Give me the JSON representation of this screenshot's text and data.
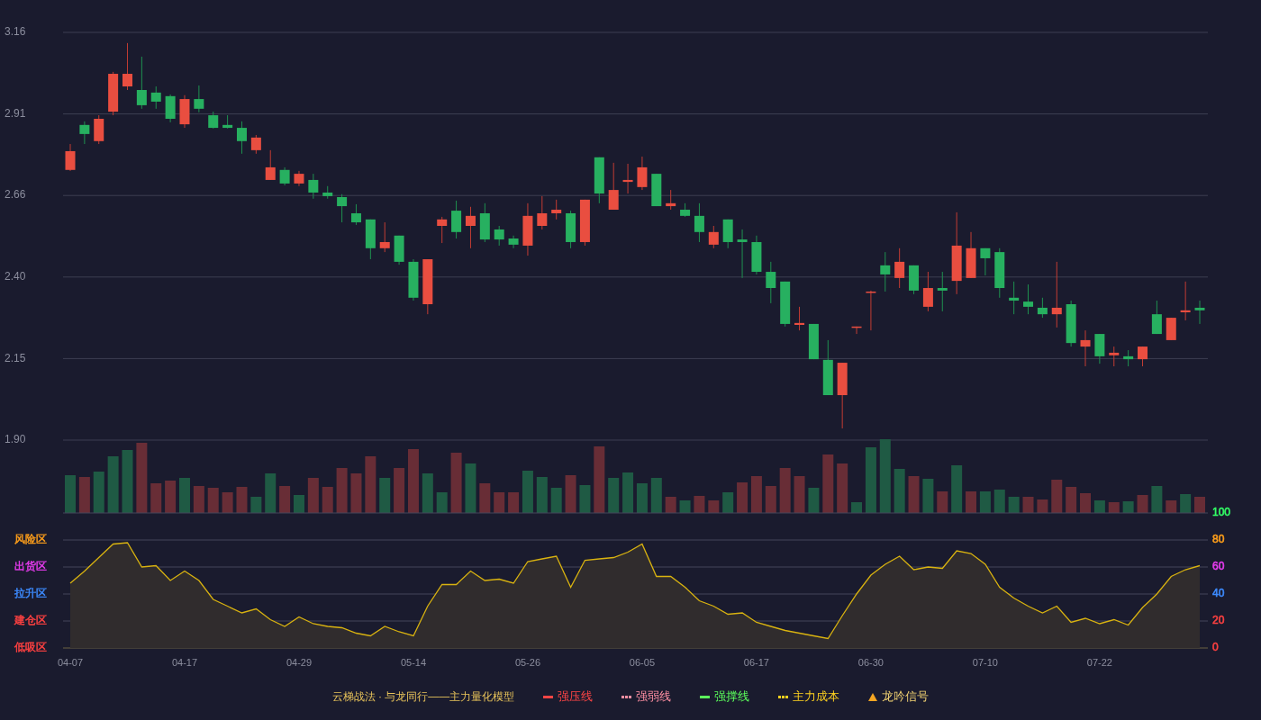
{
  "price_panel": {
    "chart_data": {
      "type": "candlestick",
      "categories": [
        null,
        null,
        null,
        null,
        null,
        null,
        null,
        null,
        null,
        null,
        null,
        null,
        null,
        null,
        null,
        null,
        null,
        null,
        null,
        null,
        null,
        null,
        null,
        null,
        null,
        null,
        null,
        null,
        null,
        null,
        null,
        null,
        null,
        null,
        null,
        null,
        null,
        null,
        null,
        null,
        null,
        null,
        null,
        null,
        null,
        null,
        null,
        null,
        null,
        null,
        null,
        null,
        null,
        null,
        null,
        null,
        null,
        null,
        null,
        null,
        null,
        null,
        null,
        null,
        null,
        null,
        null,
        null,
        null,
        null,
        null,
        null,
        null,
        null,
        null,
        null,
        null,
        null,
        null,
        null
      ],
      "ylim": [
        1.9,
        3.16
      ],
      "yticks": [
        {
          "value": 3.16,
          "label": "3.16"
        },
        {
          "value": 2.908,
          "label": "2.91"
        },
        {
          "value": 2.656,
          "label": "2.66"
        },
        {
          "value": 2.404,
          "label": "2.40"
        },
        {
          "value": 2.152,
          "label": "2.15"
        },
        {
          "value": 1.9,
          "label": "1.90"
        }
      ],
      "grid": true,
      "ohlc": [
        [
          2.735,
          2.815,
          2.732,
          2.793
        ],
        [
          2.874,
          2.885,
          2.815,
          2.846
        ],
        [
          2.824,
          2.904,
          2.815,
          2.893
        ],
        [
          2.915,
          3.038,
          2.904,
          3.032
        ],
        [
          2.993,
          3.127,
          2.982,
          3.032
        ],
        [
          2.982,
          3.085,
          2.924,
          2.935
        ],
        [
          2.974,
          2.993,
          2.924,
          2.946
        ],
        [
          2.963,
          2.968,
          2.882,
          2.893
        ],
        [
          2.876,
          2.966,
          2.865,
          2.954
        ],
        [
          2.954,
          2.996,
          2.913,
          2.924
        ],
        [
          2.904,
          2.915,
          2.863,
          2.865
        ],
        [
          2.874,
          2.904,
          2.863,
          2.865
        ],
        [
          2.865,
          2.885,
          2.785,
          2.824
        ],
        [
          2.796,
          2.843,
          2.785,
          2.835
        ],
        [
          2.704,
          2.796,
          2.704,
          2.743
        ],
        [
          2.735,
          2.743,
          2.687,
          2.693
        ],
        [
          2.693,
          2.732,
          2.685,
          2.723
        ],
        [
          2.704,
          2.723,
          2.646,
          2.665
        ],
        [
          2.665,
          2.685,
          2.646,
          2.654
        ],
        [
          2.651,
          2.66,
          2.573,
          2.623
        ],
        [
          2.601,
          2.629,
          2.565,
          2.573
        ],
        [
          2.582,
          2.582,
          2.459,
          2.493
        ],
        [
          2.493,
          2.573,
          2.481,
          2.512
        ],
        [
          2.532,
          2.532,
          2.442,
          2.451
        ],
        [
          2.451,
          2.459,
          2.331,
          2.34
        ],
        [
          2.32,
          2.459,
          2.289,
          2.459
        ],
        [
          2.562,
          2.59,
          2.509,
          2.582
        ],
        [
          2.609,
          2.64,
          2.523,
          2.543
        ],
        [
          2.562,
          2.621,
          2.493,
          2.593
        ],
        [
          2.601,
          2.632,
          2.512,
          2.52
        ],
        [
          2.551,
          2.562,
          2.501,
          2.52
        ],
        [
          2.523,
          2.532,
          2.493,
          2.504
        ],
        [
          2.501,
          2.632,
          2.47,
          2.593
        ],
        [
          2.562,
          2.654,
          2.551,
          2.601
        ],
        [
          2.601,
          2.643,
          2.582,
          2.612
        ],
        [
          2.601,
          2.609,
          2.493,
          2.512
        ],
        [
          2.512,
          2.643,
          2.501,
          2.643
        ],
        [
          2.774,
          2.774,
          2.632,
          2.662
        ],
        [
          2.612,
          2.757,
          2.612,
          2.673
        ],
        [
          2.698,
          2.754,
          2.662,
          2.704
        ],
        [
          2.682,
          2.776,
          2.673,
          2.743
        ],
        [
          2.723,
          2.723,
          2.623,
          2.623
        ],
        [
          2.623,
          2.673,
          2.612,
          2.632
        ],
        [
          2.612,
          2.632,
          2.59,
          2.593
        ],
        [
          2.593,
          2.632,
          2.512,
          2.543
        ],
        [
          2.504,
          2.562,
          2.493,
          2.543
        ],
        [
          2.582,
          2.582,
          2.493,
          2.512
        ],
        [
          2.52,
          2.551,
          2.401,
          2.512
        ],
        [
          2.512,
          2.532,
          2.412,
          2.42
        ],
        [
          2.42,
          2.451,
          2.323,
          2.37
        ],
        [
          2.39,
          2.39,
          2.251,
          2.259
        ],
        [
          2.256,
          2.312,
          2.239,
          2.262
        ],
        [
          2.259,
          2.259,
          2.15,
          2.15
        ],
        [
          2.148,
          2.209,
          2.039,
          2.039
        ],
        [
          2.039,
          2.139,
          1.936,
          2.139
        ],
        [
          2.248,
          2.251,
          2.228,
          2.251
        ],
        [
          2.356,
          2.362,
          2.239,
          2.359
        ],
        [
          2.44,
          2.481,
          2.359,
          2.412
        ],
        [
          2.401,
          2.493,
          2.37,
          2.451
        ],
        [
          2.44,
          2.44,
          2.351,
          2.362
        ],
        [
          2.312,
          2.42,
          2.298,
          2.37
        ],
        [
          2.37,
          2.42,
          2.298,
          2.362
        ],
        [
          2.392,
          2.604,
          2.351,
          2.501
        ],
        [
          2.401,
          2.543,
          2.401,
          2.493
        ],
        [
          2.493,
          2.493,
          2.409,
          2.462
        ],
        [
          2.481,
          2.493,
          2.34,
          2.37
        ],
        [
          2.34,
          2.39,
          2.289,
          2.331
        ],
        [
          2.328,
          2.381,
          2.289,
          2.312
        ],
        [
          2.309,
          2.34,
          2.278,
          2.289
        ],
        [
          2.289,
          2.451,
          2.248,
          2.309
        ],
        [
          2.32,
          2.331,
          2.189,
          2.2
        ],
        [
          2.189,
          2.239,
          2.128,
          2.209
        ],
        [
          2.228,
          2.228,
          2.136,
          2.159
        ],
        [
          2.162,
          2.189,
          2.128,
          2.17
        ],
        [
          2.159,
          2.178,
          2.128,
          2.15
        ],
        [
          2.15,
          2.189,
          2.128,
          2.189
        ],
        [
          2.289,
          2.331,
          2.228,
          2.228
        ],
        [
          2.209,
          2.278,
          2.209,
          2.278
        ],
        [
          2.295,
          2.39,
          2.27,
          2.301
        ],
        [
          2.309,
          2.331,
          2.259,
          2.301
        ]
      ]
    }
  },
  "indicator_panel": {
    "zones": [
      {
        "label": "风险区",
        "color": "#ff9f1a"
      },
      {
        "label": "出货区",
        "color": "#e83cf0"
      },
      {
        "label": "拉升区",
        "color": "#3d8bff"
      },
      {
        "label": "建仓区",
        "color": "#ff4141"
      },
      {
        "label": "低吸区",
        "color": "#ff4141"
      }
    ],
    "axis_ticks": [
      {
        "color": "#33ff66"
      },
      {
        "color": "#ff9f1a"
      },
      {
        "color": "#e83cf0"
      },
      {
        "color": "#3d8bff"
      },
      {
        "color": "#ff4141"
      },
      {
        "color": "#ff4141"
      }
    ],
    "chart_data": {
      "type": "area",
      "categories": [
        "04-07",
        null,
        null,
        null,
        null,
        null,
        null,
        null,
        "04-17",
        null,
        null,
        null,
        null,
        null,
        null,
        null,
        "04-29",
        null,
        null,
        null,
        null,
        null,
        null,
        null,
        "05-14",
        null,
        null,
        null,
        null,
        null,
        null,
        null,
        "05-26",
        null,
        null,
        null,
        null,
        null,
        null,
        null,
        "06-05",
        null,
        null,
        null,
        null,
        null,
        null,
        null,
        "06-17",
        null,
        null,
        null,
        null,
        null,
        null,
        null,
        "06-30",
        null,
        null,
        null,
        null,
        null,
        null,
        null,
        "07-10",
        null,
        null,
        null,
        null,
        null,
        null,
        null,
        "07-22",
        null,
        null,
        null,
        null,
        null,
        null,
        null
      ],
      "ylim": [
        0,
        100
      ],
      "yticks": [
        {
          "value": 100,
          "label": "100"
        },
        {
          "value": 80,
          "label": "80"
        },
        {
          "value": 60,
          "label": "60"
        },
        {
          "value": 40,
          "label": "40"
        },
        {
          "value": 20,
          "label": "20"
        },
        {
          "value": 0,
          "label": "0"
        }
      ],
      "grid": true,
      "values": [
        48,
        57,
        67,
        77,
        78,
        60,
        61,
        50,
        57,
        50,
        36,
        31,
        26,
        29,
        21,
        16,
        23,
        18,
        16,
        15,
        11,
        9,
        16,
        12,
        9,
        31,
        47,
        47,
        57,
        50,
        51,
        48,
        64,
        66,
        68,
        45,
        65,
        66,
        67,
        71,
        77,
        53,
        53,
        45,
        35,
        31,
        25,
        26,
        19,
        16,
        13,
        11,
        9,
        7,
        24,
        40,
        54,
        62,
        68,
        58,
        60,
        59,
        72,
        70,
        62,
        45,
        37,
        31,
        26,
        31,
        19,
        22,
        18,
        21,
        17,
        30,
        40,
        53,
        58,
        61
      ]
    }
  },
  "legend": {
    "title": "云梯战法 · 与龙同行——主力量化模型",
    "items": [
      {
        "label": "强压线",
        "kind": "solid",
        "color": "#ff4545"
      },
      {
        "label": "强弱线",
        "kind": "dashed",
        "color": "#ff8fa3"
      },
      {
        "label": "强撑线",
        "kind": "solid",
        "color": "#5cff5c"
      },
      {
        "label": "主力成本",
        "kind": "dashed",
        "color": "#ffd21f"
      },
      {
        "label": "龙吟信号",
        "kind": "triangle",
        "color": "#f5a623"
      }
    ]
  }
}
